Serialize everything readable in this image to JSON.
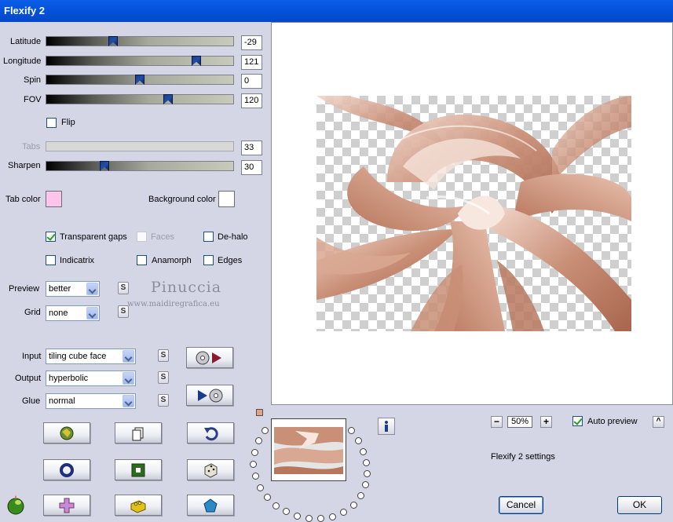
{
  "window": {
    "title": "Flexify 2"
  },
  "sliders": [
    {
      "label": "Latitude",
      "value": "-29",
      "position": 0.35
    },
    {
      "label": "Longitude",
      "value": "121",
      "position": 0.82
    },
    {
      "label": "Spin",
      "value": "0",
      "position": 0.5
    },
    {
      "label": "FOV",
      "value": "120",
      "position": 0.66
    },
    {
      "label": "Tabs",
      "value": "33",
      "position": null,
      "disabled": true
    },
    {
      "label": "Sharpen",
      "value": "30",
      "position": 0.3
    }
  ],
  "flip": {
    "label": "Flip",
    "checked": false
  },
  "colors": {
    "tab_color_label": "Tab color",
    "tab_color": "#ffc4ec",
    "background_color_label": "Background color",
    "background_color": "#ffffff"
  },
  "checkboxes": {
    "transparent_gaps": {
      "label": "Transparent gaps",
      "checked": true
    },
    "faces": {
      "label": "Faces",
      "checked": false,
      "disabled": true
    },
    "de_halo": {
      "label": "De-halo",
      "checked": false
    },
    "indicatrix": {
      "label": "Indicatrix",
      "checked": false
    },
    "anamorph": {
      "label": "Anamorph",
      "checked": false
    },
    "edges": {
      "label": "Edges",
      "checked": false
    }
  },
  "dropdowns": {
    "preview": {
      "label": "Preview",
      "value": "better"
    },
    "grid": {
      "label": "Grid",
      "value": "none"
    },
    "input": {
      "label": "Input",
      "value": "tiling cube face"
    },
    "output": {
      "label": "Output",
      "value": "hyperbolic"
    },
    "glue": {
      "label": "Glue",
      "value": "normal"
    }
  },
  "s_button_label": "S",
  "watermark": {
    "name": "Pinuccia",
    "url": "www.maidiregrafica.eu"
  },
  "zoom": {
    "minus": "−",
    "value": "50%",
    "plus": "+"
  },
  "auto_preview": {
    "label": "Auto preview",
    "checked": true,
    "toggle": "^"
  },
  "settings_name": "Flexify 2 settings",
  "buttons": {
    "cancel": "Cancel",
    "ok": "OK",
    "info": "i"
  },
  "accent": {
    "title_bar": "#0454dc",
    "preview_tone": "#c98f77"
  }
}
